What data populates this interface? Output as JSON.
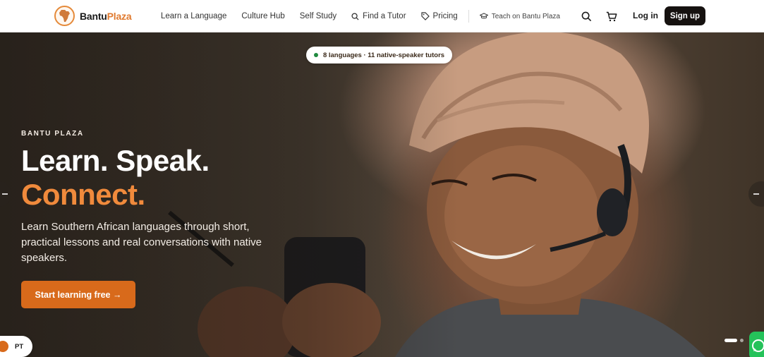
{
  "brand": {
    "name_part1": "Bantu",
    "name_part2": "Plaza",
    "accent": "#e07a2f"
  },
  "nav": {
    "items": [
      {
        "label": "Learn a Language"
      },
      {
        "label": "Culture Hub"
      },
      {
        "label": "Self Study"
      },
      {
        "label": "Find a Tutor",
        "icon": "search-icon"
      },
      {
        "label": "Pricing",
        "icon": "tag-icon"
      }
    ],
    "teach_label": "Teach on Bantu Plaza",
    "teach_icon": "graduation-cap-icon"
  },
  "header": {
    "search_icon": "search-icon",
    "cart_icon": "cart-icon",
    "login_label": "Log in",
    "signup_label": "Sign up"
  },
  "hero": {
    "pill_text": "8 languages · 11 native-speaker tutors",
    "eyebrow": "BANTU PLAZA",
    "headline_line1": "Learn. Speak.",
    "headline_line2": "Connect.",
    "subtitle": "Learn Southern African languages through short, practical lessons and real conversations with native speakers.",
    "cta_label": "Start learning free →",
    "prev_icon": "chevron-left-icon",
    "next_icon": "chevron-right-icon",
    "slides_total": 2,
    "slide_active": 1
  },
  "language_switch": {
    "label": "PT"
  },
  "whatsapp": {
    "icon": "whatsapp-icon"
  },
  "colors": {
    "cta": "#d86a1b",
    "headline_accent": "#f08a3c",
    "dark_button": "#161210"
  }
}
